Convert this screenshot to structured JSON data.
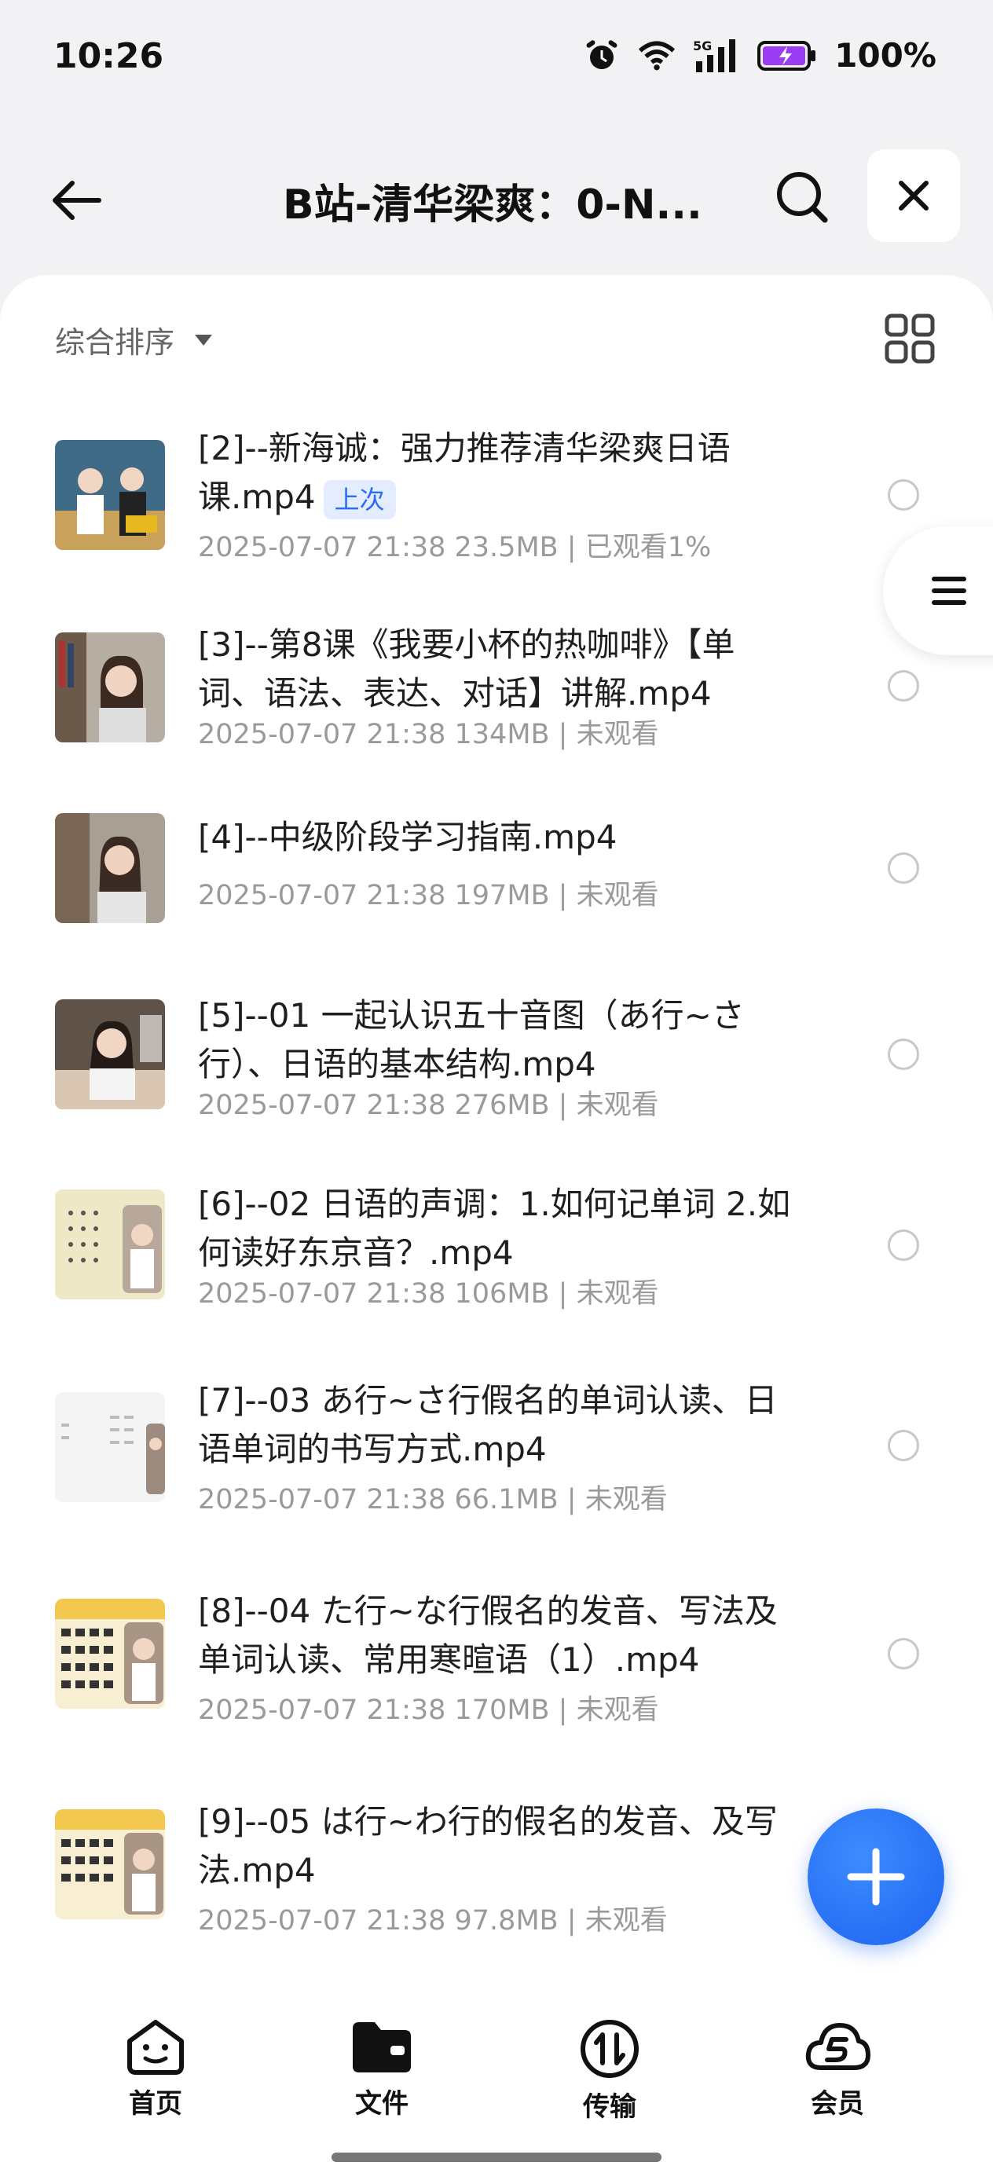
{
  "status_bar": {
    "time": "10:26",
    "network": "5G",
    "battery": "100%"
  },
  "header": {
    "title": "B站-清华梁爽：0-N..."
  },
  "toolbar": {
    "sort_label": "综合排序"
  },
  "files": [
    {
      "name": "[2]--新海诚：强力推荐清华梁爽日语课.mp4",
      "badge": "上次",
      "meta": "2025-07-07 21:38  23.5MB | 已观看1%",
      "thumb_color": "#4a6f8a"
    },
    {
      "name": "[3]--第8课《我要小杯的热咖啡》【单词、语法、表达、对话】讲解.mp4",
      "meta": "2025-07-07 21:38  134MB | 未观看",
      "thumb_color": "#b9b2a8"
    },
    {
      "name": "[4]--中级阶段学习指南.mp4",
      "meta": "2025-07-07 21:38  197MB | 未观看",
      "thumb_color": "#a9a39a"
    },
    {
      "name": "[5]--01 一起认识五十音图（あ行~さ行）、日语的基本结构.mp4",
      "meta": "2025-07-07 21:38  276MB | 未观看",
      "thumb_color": "#8c7e70"
    },
    {
      "name": "[6]--02 日语的声调：1.如何记单词 2.如何读好东京音？.mp4",
      "meta": "2025-07-07 21:38  106MB | 未观看",
      "thumb_color": "#efe8c8"
    },
    {
      "name": "[7]--03 あ行~さ行假名的单词认读、日语单词的书写方式.mp4",
      "meta": "2025-07-07 21:38  66.1MB | 未观看",
      "thumb_color": "#f4f4f4"
    },
    {
      "name": "[8]--04 た行~な行假名的发音、写法及单词认读、常用寒暄语（1）.mp4",
      "meta": "2025-07-07 21:38  170MB | 未观看",
      "thumb_color": "#f6e3a0"
    },
    {
      "name": "[9]--05 は行~わ行的假名的发音、及写法.mp4",
      "meta": "2025-07-07 21:38  97.8MB | 未观看",
      "thumb_color": "#f6e3a0"
    }
  ],
  "nav": [
    {
      "label": "首页",
      "icon": "home-face-icon"
    },
    {
      "label": "文件",
      "icon": "folder-icon"
    },
    {
      "label": "传输",
      "icon": "transfer-icon"
    },
    {
      "label": "会员",
      "icon": "vip-cloud-icon"
    }
  ]
}
